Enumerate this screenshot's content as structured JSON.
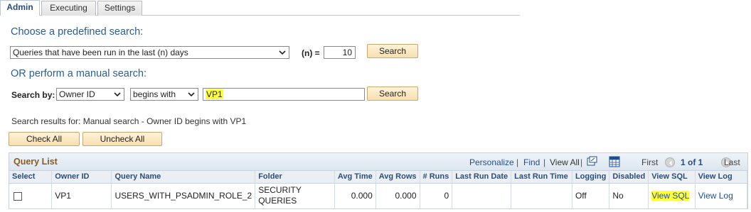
{
  "tabs": [
    "Admin",
    "Executing",
    "Settings"
  ],
  "predefined": {
    "heading": "Choose a predefined search:",
    "select_value": "Queries that have been run in the last (n) days",
    "n_label": "(n) =",
    "n_value": "10",
    "search_label": "Search"
  },
  "manual": {
    "heading": "OR perform a manual search:",
    "search_by_label": "Search by:",
    "field_value": "Owner ID",
    "operator_value": "begins with",
    "search_value": "VP1",
    "search_label": "Search"
  },
  "results_text": "Search results for: Manual search - Owner ID begins with VP1",
  "buttons": {
    "check_all": "Check All",
    "uncheck_all": "Uncheck All"
  },
  "grid": {
    "title": "Query List",
    "personalize": "Personalize",
    "find": "Find",
    "view_all": "View All",
    "first": "First",
    "pager": "1 of 1",
    "last": "Last",
    "columns": [
      "Select",
      "Owner ID",
      "Query Name",
      "Folder",
      "Avg Time",
      "Avg Rows",
      "# Runs",
      "Last Run Date",
      "Last Run Time",
      "Logging",
      "Disabled",
      "View SQL",
      "View Log"
    ],
    "rows": [
      {
        "owner_id": "VP1",
        "query_name": "USERS_WITH_PSADMIN_ROLE_2",
        "folder_line1": "SECURITY",
        "folder_line2": "QUERIES",
        "avg_time": "0.000",
        "avg_rows": "0.000",
        "runs": "0",
        "last_run_date": "",
        "last_run_time": "",
        "logging": "Off",
        "disabled": "No",
        "view_sql": "View SQL",
        "view_log": "View Log"
      }
    ]
  },
  "colors": {
    "heading": "#2a5f8f",
    "highlight": "#ffff38",
    "link": "#1f4e96",
    "grid_title": "#8a5a24"
  }
}
